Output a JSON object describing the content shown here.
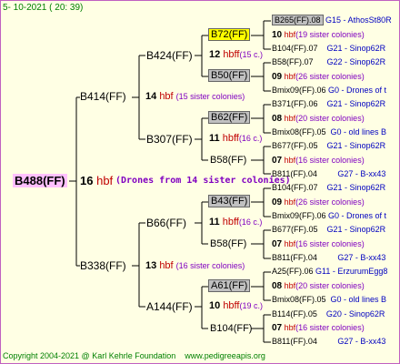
{
  "header": {
    "date": "5- 10-2021 ( 20: 39)"
  },
  "footer": {
    "copyright": "Copyright 2004-2021 @ Karl Kehrle Foundation",
    "url": "www.pedigreeapis.org"
  },
  "colors": {
    "queen_highlight": "#ffff00",
    "drone_highlight": "#c0c0c0",
    "root_highlight": "#ffc0ff",
    "hbf": "#c00000",
    "sister": "#8000c0",
    "origin": "#0000c0"
  },
  "root": {
    "name": "B488(FF)",
    "num": "16",
    "hbf": "hbf",
    "sisters": "(Drones from 14 sister colonies)"
  },
  "g1": [
    {
      "name": "B414(FF)",
      "num": "14",
      "hbf": "hbf",
      "sisters": "(15 sister colonies)"
    },
    {
      "name": "B338(FF)",
      "num": "13",
      "hbf": "hbf",
      "sisters": "(16 sister colonies)"
    }
  ],
  "g2": [
    {
      "name": "B424(FF)",
      "num": "12",
      "hbf": "hbff",
      "sisters": "(15 c.)"
    },
    {
      "name": "B307(FF)",
      "num": "11",
      "hbf": "hbff",
      "sisters": "(16 c.)"
    },
    {
      "name": "B66(FF)",
      "num": "11",
      "hbf": "hbff",
      "sisters": "(16 c.)"
    },
    {
      "name": "A144(FF)",
      "num": "10",
      "hbf": "hbff",
      "sisters": "(19 c.)"
    }
  ],
  "g3": [
    {
      "name": "B72(FF)"
    },
    {
      "name": "B50(FF)"
    },
    {
      "name": "B62(FF)"
    },
    {
      "name": "B58(FF)"
    },
    {
      "name": "B43(FF)"
    },
    {
      "name": "B58(FF)"
    },
    {
      "name": "A61(FF)"
    },
    {
      "name": "B104(FF)"
    }
  ],
  "g4": [
    {
      "name": "B265(FF).08",
      "origin": "G15 - AthosSt80R"
    },
    {
      "num": "10",
      "hbf": "hbf",
      "sisters": "(19 sister colonies)"
    },
    {
      "name": "B104(FF).07",
      "origin": "G21 - Sinop62R"
    },
    {
      "name": "B58(FF).07",
      "origin": "G22 - Sinop62R"
    },
    {
      "num": "09",
      "hbf": "hbf",
      "sisters": "(26 sister colonies)"
    },
    {
      "name": "Bmix09(FF).06",
      "origin": "G0 - Drones of t"
    },
    {
      "name": "B371(FF).06",
      "origin": "G21 - Sinop62R"
    },
    {
      "num": "08",
      "hbf": "hbf",
      "sisters": "(20 sister colonies)"
    },
    {
      "name": "Bmix08(FF).05",
      "origin": "G0 - old lines B"
    },
    {
      "name": "B677(FF).05",
      "origin": "G21 - Sinop62R"
    },
    {
      "num": "07",
      "hbf": "hbf",
      "sisters": "(16 sister colonies)"
    },
    {
      "name": "B811(FF).04",
      "origin": "G27 - B-xx43"
    },
    {
      "name": "B104(FF).07",
      "origin": "G21 - Sinop62R"
    },
    {
      "num": "09",
      "hbf": "hbf",
      "sisters": "(26 sister colonies)"
    },
    {
      "name": "Bmix09(FF).06",
      "origin": "G0 - Drones of t"
    },
    {
      "name": "B677(FF).05",
      "origin": "G21 - Sinop62R"
    },
    {
      "num": "07",
      "hbf": "hbf",
      "sisters": "(16 sister colonies)"
    },
    {
      "name": "B811(FF).04",
      "origin": "G27 - B-xx43"
    },
    {
      "name": "A25(FF).06",
      "origin": "G11 - ErzurumEgg8"
    },
    {
      "num": "08",
      "hbf": "hbf",
      "sisters": "(20 sister colonies)"
    },
    {
      "name": "Bmix08(FF).05",
      "origin": "G0 - old lines B"
    },
    {
      "name": "B114(FF).05",
      "origin": "G20 - Sinop62R"
    },
    {
      "num": "07",
      "hbf": "hbf",
      "sisters": "(16 sister colonies)"
    },
    {
      "name": "B811(FF).04",
      "origin": "G27 - B-xx43"
    }
  ]
}
